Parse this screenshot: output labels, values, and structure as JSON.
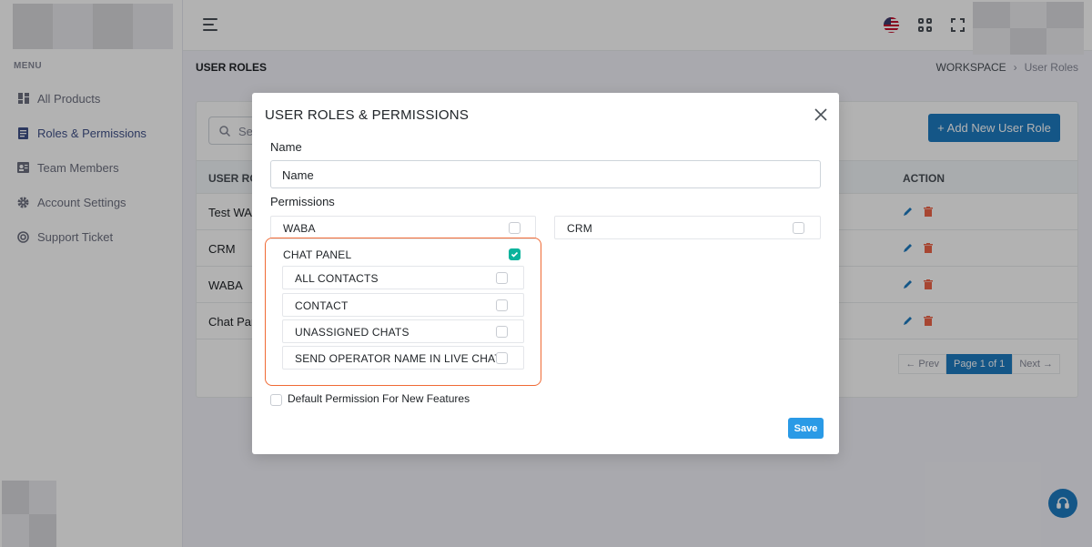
{
  "sidebar": {
    "menu_title": "MENU",
    "items": [
      {
        "label": "All Products",
        "icon": "dashboard-icon"
      },
      {
        "label": "Roles & Permissions",
        "icon": "list-icon",
        "active": true
      },
      {
        "label": "Team Members",
        "icon": "contacts-icon"
      },
      {
        "label": "Account Settings",
        "icon": "gear-icon"
      },
      {
        "label": "Support Ticket",
        "icon": "lifebuoy-icon"
      }
    ]
  },
  "page": {
    "title": "USER ROLES",
    "breadcrumb": {
      "parent": "WORKSPACE",
      "separator": "›",
      "current": "User Roles"
    }
  },
  "card": {
    "search_placeholder": "Se",
    "add_button": "+ Add New User Role",
    "columns": [
      "USER RO",
      "ACTION"
    ],
    "rows": [
      "Test WAB",
      "CRM",
      "WABA",
      "Chat Par"
    ],
    "pagination": {
      "prev": "← Prev",
      "page": "Page 1 of 1",
      "next": "Next →"
    }
  },
  "modal": {
    "title": "USER ROLES & PERMISSIONS",
    "name_label": "Name",
    "name_placeholder": "Name",
    "permissions_label": "Permissions",
    "permissions": {
      "waba": {
        "label": "WABA",
        "checked": false
      },
      "crm": {
        "label": "CRM",
        "checked": false
      },
      "chat_panel": {
        "label": "CHAT PANEL",
        "checked": true,
        "children": [
          {
            "label": "ALL CONTACTS",
            "checked": false
          },
          {
            "label": "CONTACT",
            "checked": false
          },
          {
            "label": "UNASSIGNED CHATS",
            "checked": false
          },
          {
            "label": "SEND OPERATOR NAME IN LIVE CHAT",
            "checked": false
          }
        ]
      }
    },
    "default_permission_label": "Default Permission For New Features",
    "save_label": "Save"
  },
  "colors": {
    "primary": "#1e7bc2",
    "success": "#0ab39c",
    "highlight": "#f06a35",
    "danger": "#f06548"
  }
}
